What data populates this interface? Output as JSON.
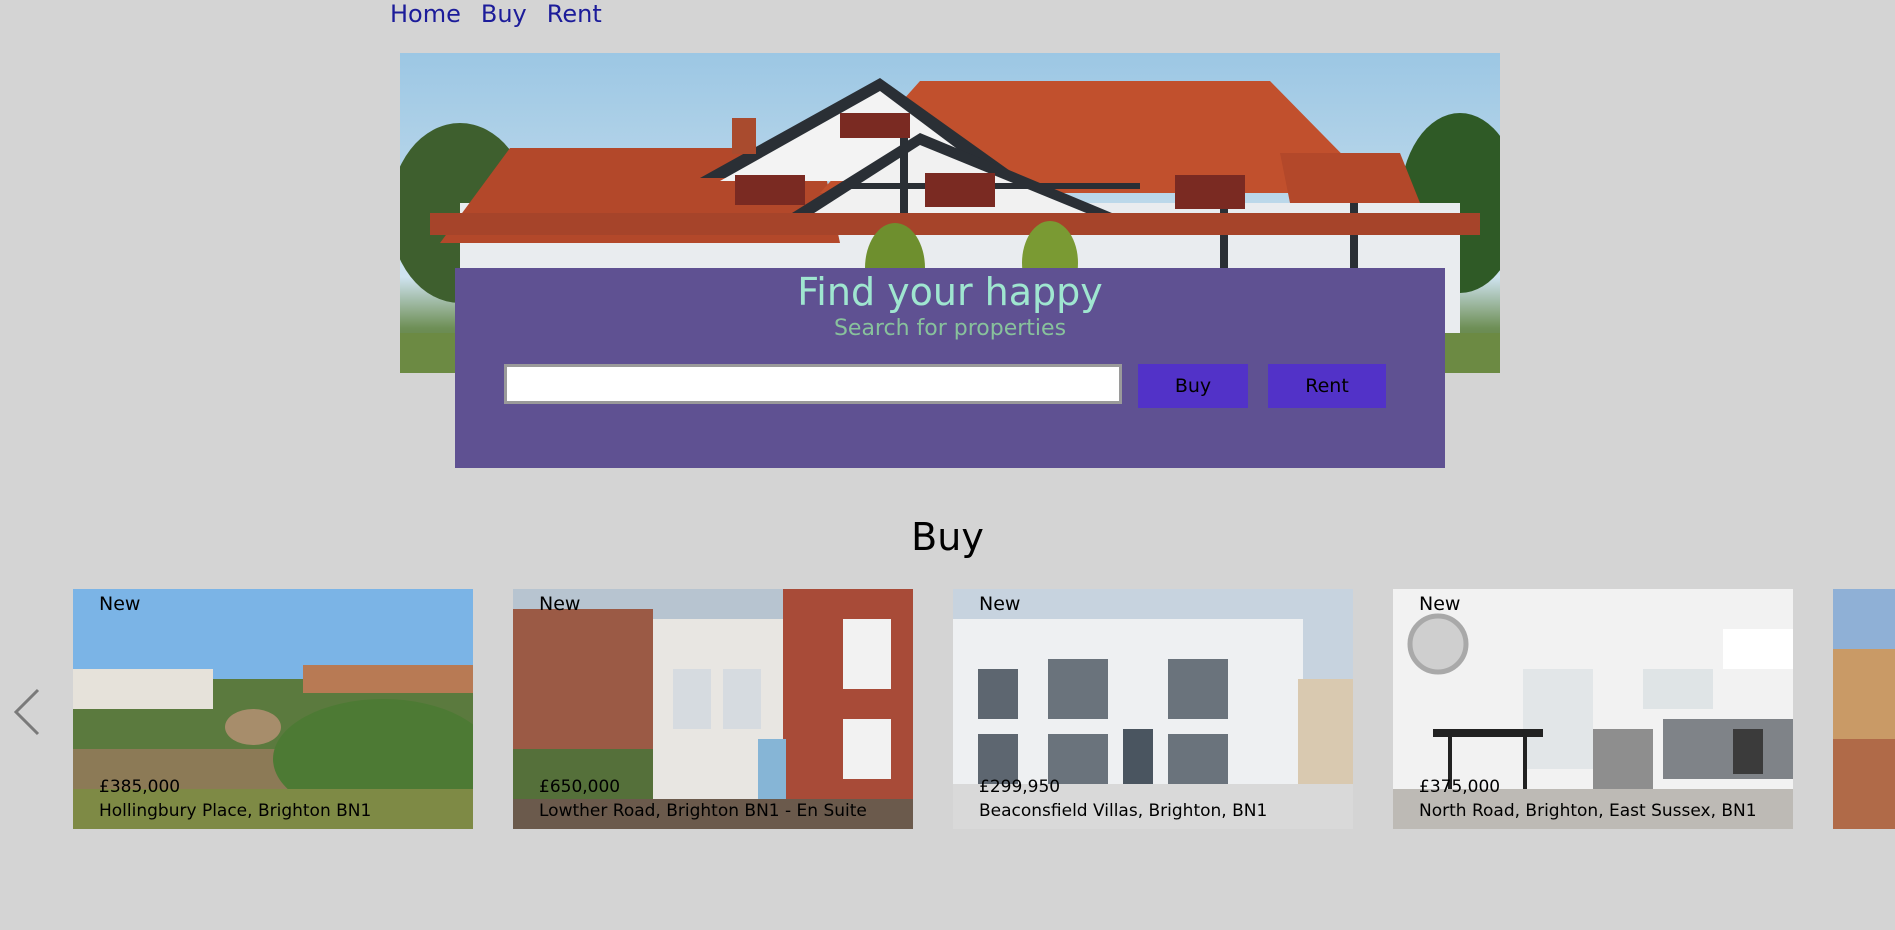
{
  "nav": {
    "items": [
      "Home",
      "Buy",
      "Rent"
    ]
  },
  "hero": {
    "image_alt": "house-photo"
  },
  "search": {
    "title": "Find your happy",
    "subtitle": "Search for properties",
    "input_value": "",
    "buy_label": "Buy",
    "rent_label": "Rent"
  },
  "section": {
    "title": "Buy"
  },
  "listings": [
    {
      "badge": "New",
      "price": "£385,000",
      "address": "Hollingbury Place, Brighton BN1"
    },
    {
      "badge": "New",
      "price": "£650,000",
      "address": "Lowther Road, Brighton BN1 - En Suite"
    },
    {
      "badge": "New",
      "price": "£299,950",
      "address": "Beaconsfield Villas, Brighton, BN1"
    },
    {
      "badge": "New",
      "price": "£375,000",
      "address": "North Road, Brighton, East Sussex, BN1"
    }
  ],
  "icons": {
    "prev": "chevron-left-icon",
    "next": "chevron-right-icon"
  },
  "colors": {
    "background": "#d4d4d4",
    "nav_link": "#1c1c9a",
    "search_panel": "#5f5192",
    "title": "#9fe6d0",
    "subtitle": "#88c29c",
    "button": "#5232c8"
  }
}
